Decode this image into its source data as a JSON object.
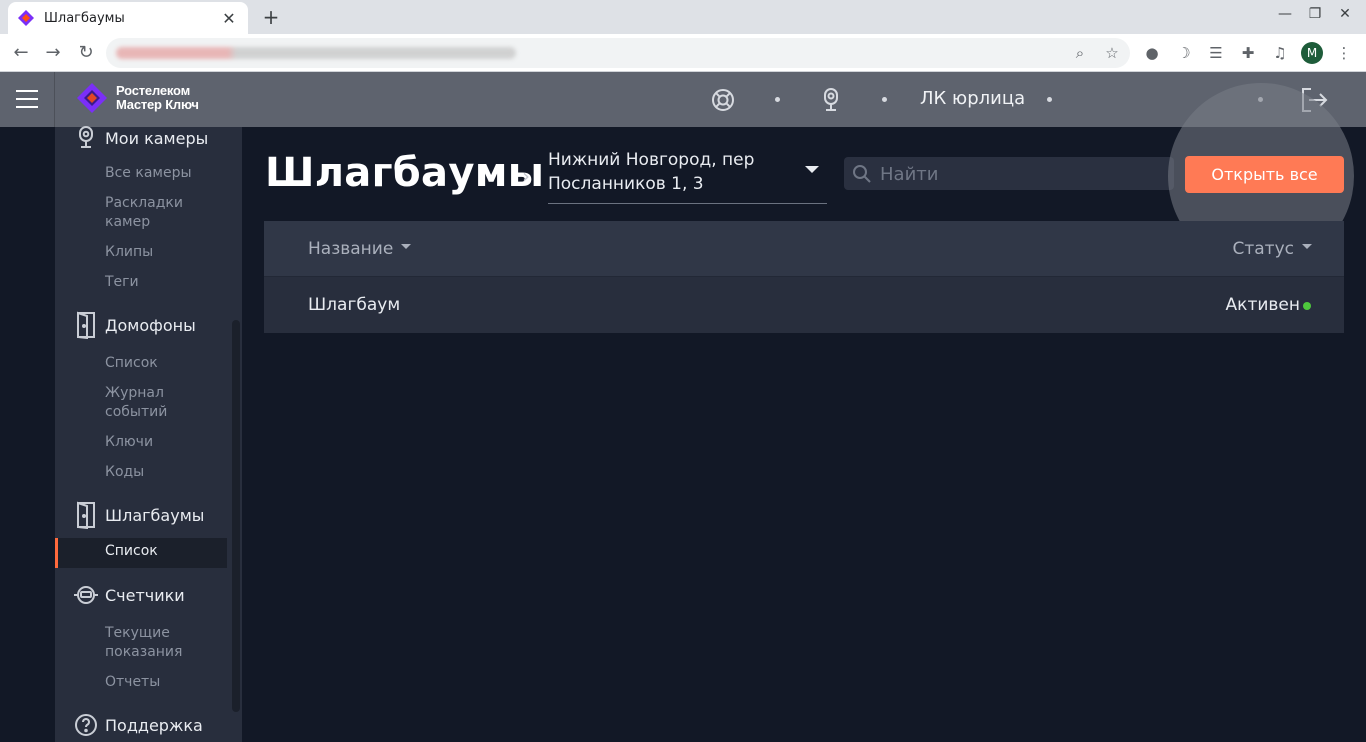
{
  "browser": {
    "tab_title": "Шлагбаумы",
    "new_tab": "+",
    "close": "✕",
    "avatar_letter": "M"
  },
  "header": {
    "logo_line1": "Ростелеком",
    "logo_line2": "Мастер Ключ",
    "account_label": "ЛК юрлица",
    "icons": [
      "support-icon",
      "camera-icon",
      "logout-icon"
    ]
  },
  "sidebar": {
    "sections": [
      {
        "label": "Мои камеры",
        "icon": "camera-icon",
        "items": [
          "Все камеры",
          "Раскладки камер",
          "Клипы",
          "Теги"
        ]
      },
      {
        "label": "Домофоны",
        "icon": "door-icon",
        "items": [
          "Список",
          "Журнал событий",
          "Ключи",
          "Коды"
        ]
      },
      {
        "label": "Шлагбаумы",
        "icon": "barrier-icon",
        "items": [
          "Список"
        ],
        "active_item": "Список"
      },
      {
        "label": "Счетчики",
        "icon": "meter-icon",
        "items": [
          "Текущие показания",
          "Отчеты"
        ]
      },
      {
        "label": "Поддержка",
        "icon": "help-icon",
        "items": []
      }
    ]
  },
  "main": {
    "title": "Шлагбаумы",
    "address_line1": "Нижний Новгород, пер",
    "address_line2": "Посланников 1, 3",
    "search_placeholder": "Найти",
    "open_all_label": "Открыть все",
    "columns": {
      "name": "Название",
      "status": "Статус"
    },
    "rows": [
      {
        "name": "Шлагбаум",
        "status": "Активен",
        "status_color": "#4ec83d"
      }
    ]
  },
  "colors": {
    "accent": "#ff7a55",
    "active_marker": "#ff6a3d",
    "background": "#121826",
    "header": "#5e636e",
    "sidebar": "#282e3d"
  }
}
